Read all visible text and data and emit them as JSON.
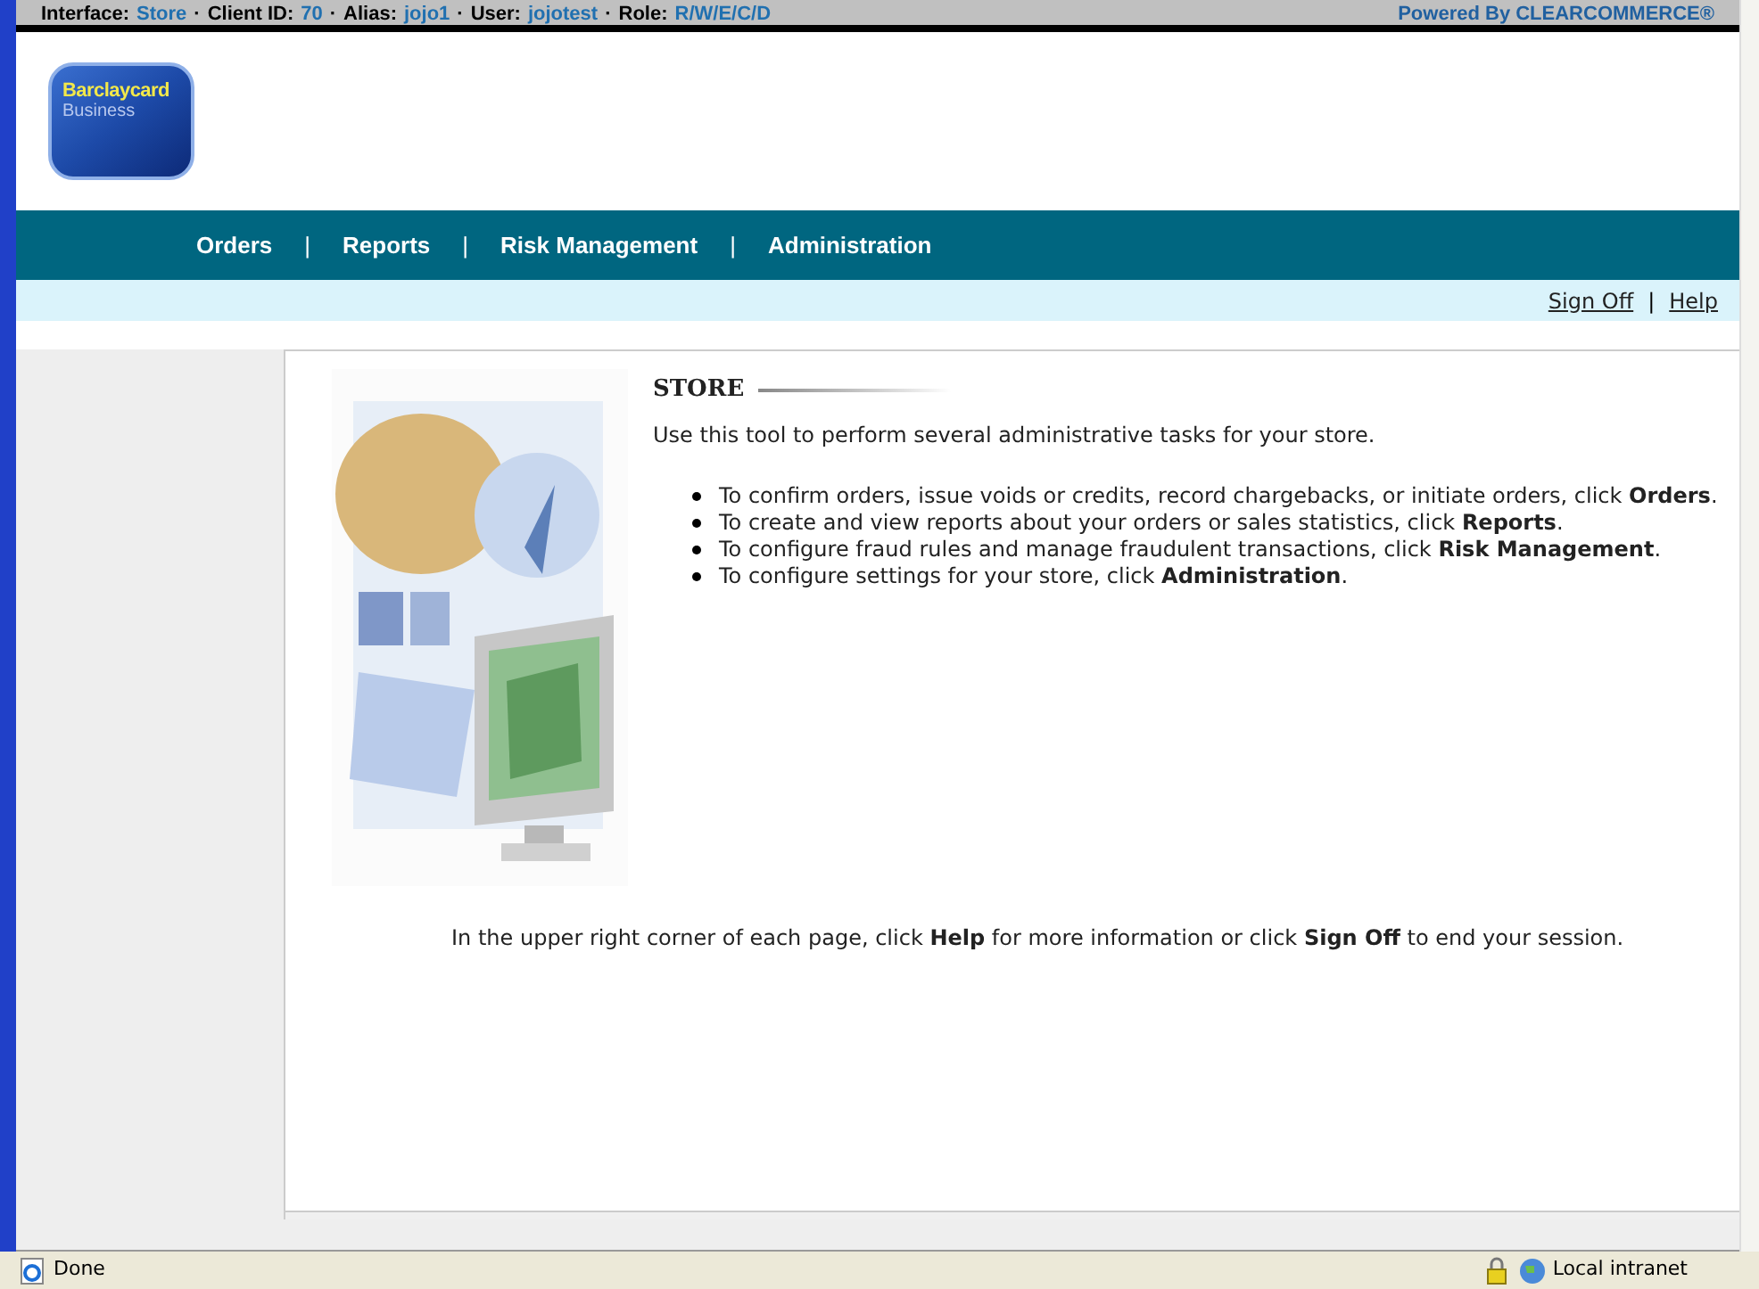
{
  "info_bar": {
    "segments": [
      {
        "label": "Interface:",
        "value": "Store"
      },
      {
        "label": "Client ID:",
        "value": "70"
      },
      {
        "label": "Alias:",
        "value": "jojo1"
      },
      {
        "label": "User:",
        "value": "jojotest"
      },
      {
        "label": "Role:",
        "value": "R/W/E/C/D"
      }
    ],
    "separator": "·",
    "powered_by": "Powered By CLEARCOMMERCE®"
  },
  "logo": {
    "brand": "Barclaycard",
    "sub": "Business"
  },
  "nav": {
    "items": [
      "Orders",
      "Reports",
      "Risk Management",
      "Administration"
    ],
    "separator": "|"
  },
  "sub_bar": {
    "links": [
      "Sign Off",
      "Help"
    ],
    "separator": "|"
  },
  "content": {
    "title": "STORE",
    "intro": "Use this tool to perform several administrative tasks for your store.",
    "bullets": [
      "To confirm orders, issue voids or credits, record chargebacks, or initiate orders, click **Orders**.",
      "To create and view reports about your orders or sales statistics, click **Reports**.",
      "To configure fraud rules and manage fraudulent transactions, click **Risk Management**.",
      "To configure settings for your store, click **Administration**."
    ],
    "footer": "In the upper right corner of each page, click **Help** for more information or click **Sign Off** to end your session."
  },
  "status_bar": {
    "status": "Done",
    "zone": "Local intranet"
  }
}
